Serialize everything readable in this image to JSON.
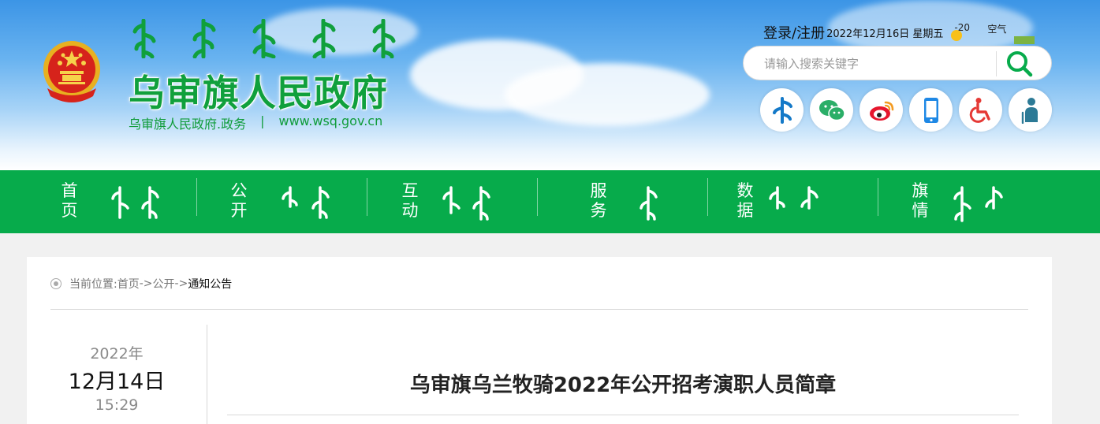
{
  "header": {
    "site_title": "乌审旗人民政府",
    "site_name_sub": "乌审旗人民政府.政务",
    "sub_separator": "|",
    "domain": "www.wsq.gov.cn",
    "login_label": "登录/注册",
    "date_text": "2022年12月16日 星期五",
    "temperature": "-20",
    "air_label": "空气",
    "search_placeholder": "请输入搜索关键字",
    "icons": [
      "mongolian-script-icon",
      "wechat-icon",
      "weibo-icon",
      "mobile-icon",
      "accessibility-icon",
      "elderly-icon"
    ]
  },
  "nav": {
    "items": [
      {
        "label": "首页",
        "line1": "首",
        "line2": "页"
      },
      {
        "label": "公开",
        "line1": "公",
        "line2": "开"
      },
      {
        "label": "互动",
        "line1": "互",
        "line2": "动"
      },
      {
        "label": "服务",
        "line1": "服",
        "line2": "务"
      },
      {
        "label": "数据",
        "line1": "数",
        "line2": "据"
      },
      {
        "label": "旗情",
        "line1": "旗",
        "line2": "情"
      }
    ]
  },
  "breadcrumb": {
    "prefix": "当前位置:",
    "home": "首页",
    "arrow1": "->",
    "section": "公开",
    "arrow2": "->",
    "current": "通知公告"
  },
  "article": {
    "year": "2022年",
    "day": "12月14日",
    "time": "15:29",
    "title": "乌审旗乌兰牧骑2022年公开招考演职人员简章"
  },
  "colors": {
    "brand_green": "#07ab4b",
    "title_green": "#10a03c"
  }
}
